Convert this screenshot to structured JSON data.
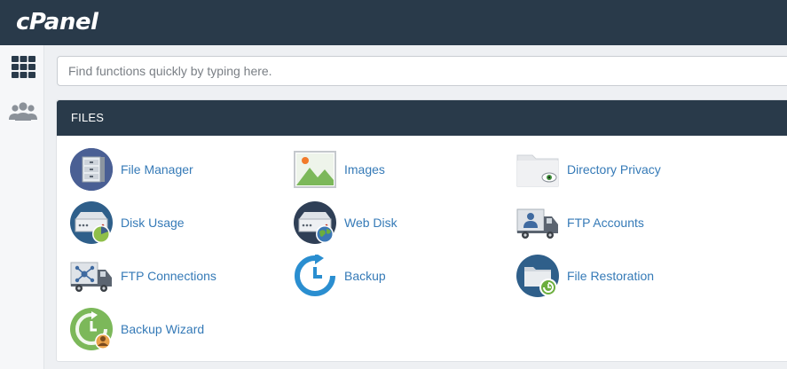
{
  "app": {
    "logo": "cPanel"
  },
  "search": {
    "placeholder": "Find functions quickly by typing here."
  },
  "files_section": {
    "title": "FILES",
    "items": [
      {
        "label": "File Manager",
        "icon": "file-manager-icon"
      },
      {
        "label": "Images",
        "icon": "images-icon"
      },
      {
        "label": "Directory Privacy",
        "icon": "directory-privacy-icon"
      },
      {
        "label": "Disk Usage",
        "icon": "disk-usage-icon"
      },
      {
        "label": "Web Disk",
        "icon": "web-disk-icon"
      },
      {
        "label": "FTP Accounts",
        "icon": "ftp-accounts-icon"
      },
      {
        "label": "FTP Connections",
        "icon": "ftp-connections-icon"
      },
      {
        "label": "Backup",
        "icon": "backup-icon"
      },
      {
        "label": "File Restoration",
        "icon": "file-restoration-icon"
      },
      {
        "label": "Backup Wizard",
        "icon": "backup-wizard-icon"
      }
    ]
  },
  "sidebar": {
    "items": [
      {
        "icon": "grid-icon"
      },
      {
        "icon": "users-icon"
      }
    ]
  },
  "colors": {
    "header_bg": "#293a4a",
    "link": "#357ab7",
    "page_bg": "#eef0f3"
  }
}
